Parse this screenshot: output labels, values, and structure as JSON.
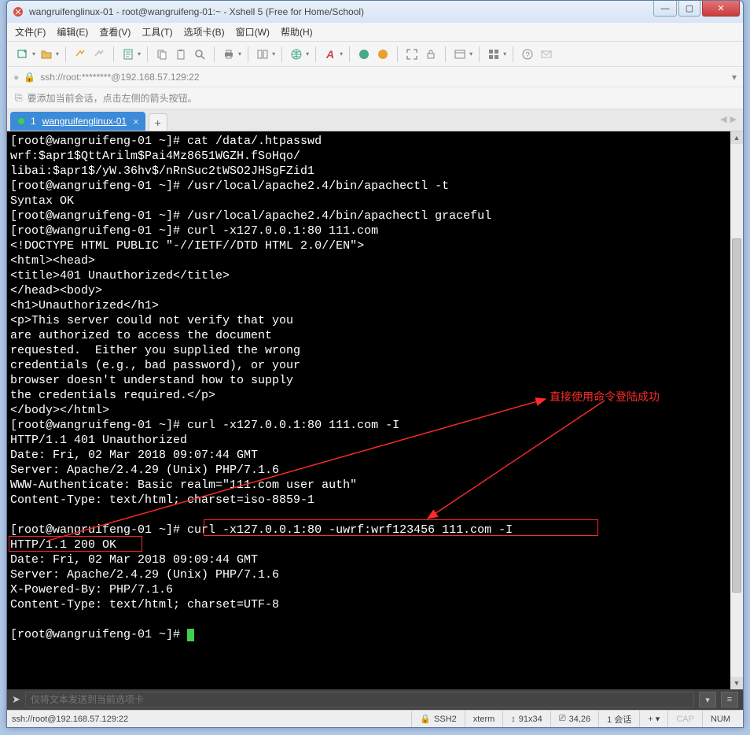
{
  "window": {
    "title": "wangruifenglinux-01 - root@wangruifeng-01:~ - Xshell 5 (Free for Home/School)"
  },
  "menu": {
    "file": "文件(F)",
    "edit": "编辑(E)",
    "view": "查看(V)",
    "tools": "工具(T)",
    "tabs": "选项卡(B)",
    "window": "窗口(W)",
    "help": "帮助(H)"
  },
  "address": {
    "text": "ssh://root:********@192.168.57.129:22"
  },
  "hint": {
    "text": "要添加当前会话，点击左侧的箭头按钮。"
  },
  "tab": {
    "index": "1",
    "name": "wangruifenglinux-01"
  },
  "terminal_lines": [
    "[root@wangruifeng-01 ~]# cat /data/.htpasswd",
    "wrf:$apr1$QttArilm$Pai4Mz8651WGZH.fSoHqo/",
    "libai:$apr1$/yW.36hv$/nRnSuc2tWSO2JHSgFZid1",
    "[root@wangruifeng-01 ~]# /usr/local/apache2.4/bin/apachectl -t",
    "Syntax OK",
    "[root@wangruifeng-01 ~]# /usr/local/apache2.4/bin/apachectl graceful",
    "[root@wangruifeng-01 ~]# curl -x127.0.0.1:80 111.com",
    "<!DOCTYPE HTML PUBLIC \"-//IETF//DTD HTML 2.0//EN\">",
    "<html><head>",
    "<title>401 Unauthorized</title>",
    "</head><body>",
    "<h1>Unauthorized</h1>",
    "<p>This server could not verify that you",
    "are authorized to access the document",
    "requested.  Either you supplied the wrong",
    "credentials (e.g., bad password), or your",
    "browser doesn't understand how to supply",
    "the credentials required.</p>",
    "</body></html>",
    "[root@wangruifeng-01 ~]# curl -x127.0.0.1:80 111.com -I",
    "HTTP/1.1 401 Unauthorized",
    "Date: Fri, 02 Mar 2018 09:07:44 GMT",
    "Server: Apache/2.4.29 (Unix) PHP/7.1.6",
    "WWW-Authenticate: Basic realm=\"111.com user auth\"",
    "Content-Type: text/html; charset=iso-8859-1",
    "",
    "[root@wangruifeng-01 ~]# curl -x127.0.0.1:80 -uwrf:wrf123456 111.com -I",
    "HTTP/1.1 200 OK",
    "Date: Fri, 02 Mar 2018 09:09:44 GMT",
    "Server: Apache/2.4.29 (Unix) PHP/7.1.6",
    "X-Powered-By: PHP/7.1.6",
    "Content-Type: text/html; charset=UTF-8",
    "",
    "[root@wangruifeng-01 ~]# "
  ],
  "annotation": {
    "text": "直接使用命令登陆成功"
  },
  "sendbar": {
    "placeholder": "仅将文本发送到当前选项卡"
  },
  "status": {
    "left": "ssh://root@192.168.57.129:22",
    "ssh": "SSH2",
    "term": "xterm",
    "size": "91x34",
    "pos": "34,26",
    "sessions": "1 会话",
    "cap": "CAP",
    "num": "NUM"
  }
}
